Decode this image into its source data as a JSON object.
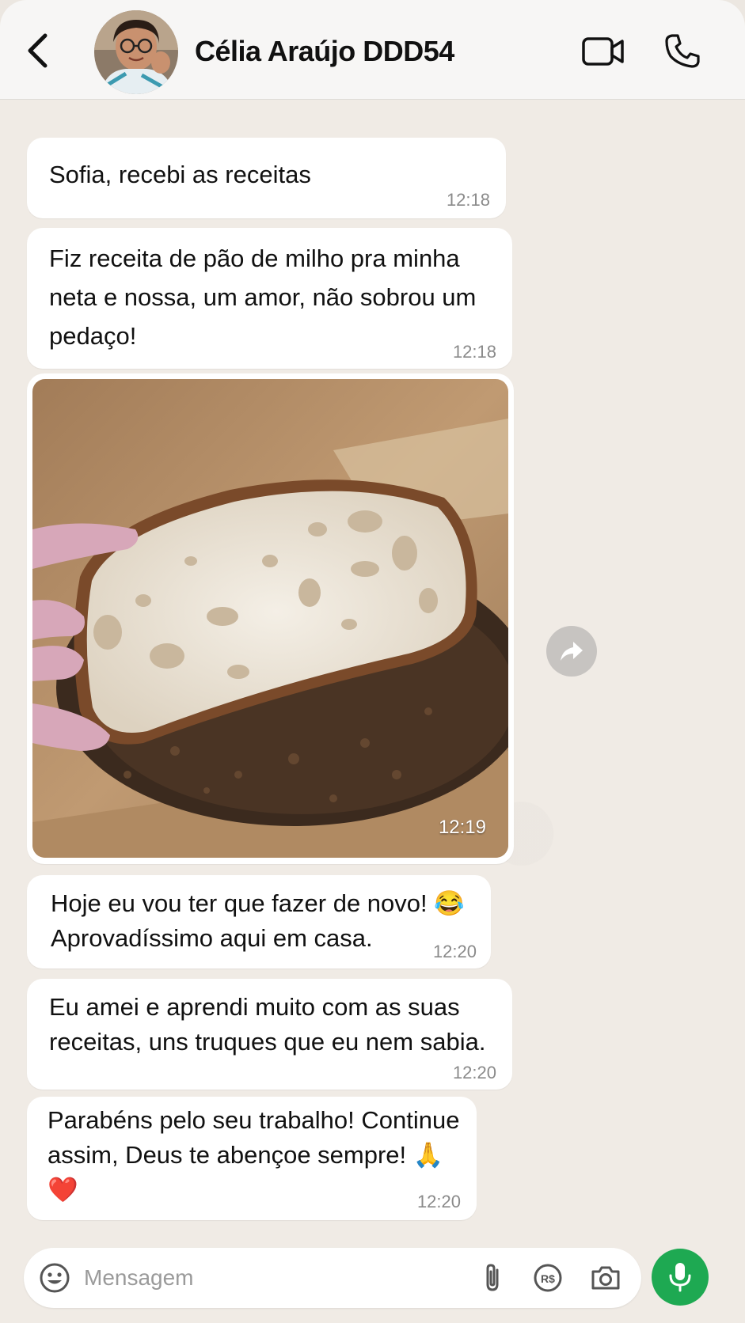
{
  "header": {
    "contact_name": "Célia Araújo DDD54",
    "back_icon": "chevron-left-icon",
    "video_icon": "video-camera-icon",
    "call_icon": "phone-icon"
  },
  "messages": [
    {
      "text": "Sofia, recebi as receitas",
      "time": "12:18"
    },
    {
      "text": "Fiz receita de pão de milho pra minha\nneta e nossa, um amor, não sobrou um\npedaço!",
      "time": "12:18"
    },
    {
      "type": "image",
      "subject": "bread",
      "time": "12:19"
    },
    {
      "text": "Hoje eu vou ter que fazer de novo! 😂\nAprovadíssimo aqui em casa.",
      "time": "12:20"
    },
    {
      "text": "Eu amei e aprendi muito com as suas\nreceitas, uns truques que eu nem sabia.",
      "time": "12:20"
    },
    {
      "text": "Parabéns pelo seu trabalho! Continue\nassim, Deus te abençoe sempre! 🙏\n❤️",
      "time": "12:20"
    }
  ],
  "input": {
    "placeholder": "Mensagem",
    "value": ""
  },
  "icons": {
    "forward": "forward-icon",
    "emoji": "emoji-icon",
    "attach": "paperclip-icon",
    "payment": "payment-icon",
    "camera": "camera-icon",
    "mic": "microphone-icon"
  },
  "colors": {
    "accent": "#1ea952",
    "bubble": "#ffffff",
    "chat_background": "#f0ebe5"
  }
}
